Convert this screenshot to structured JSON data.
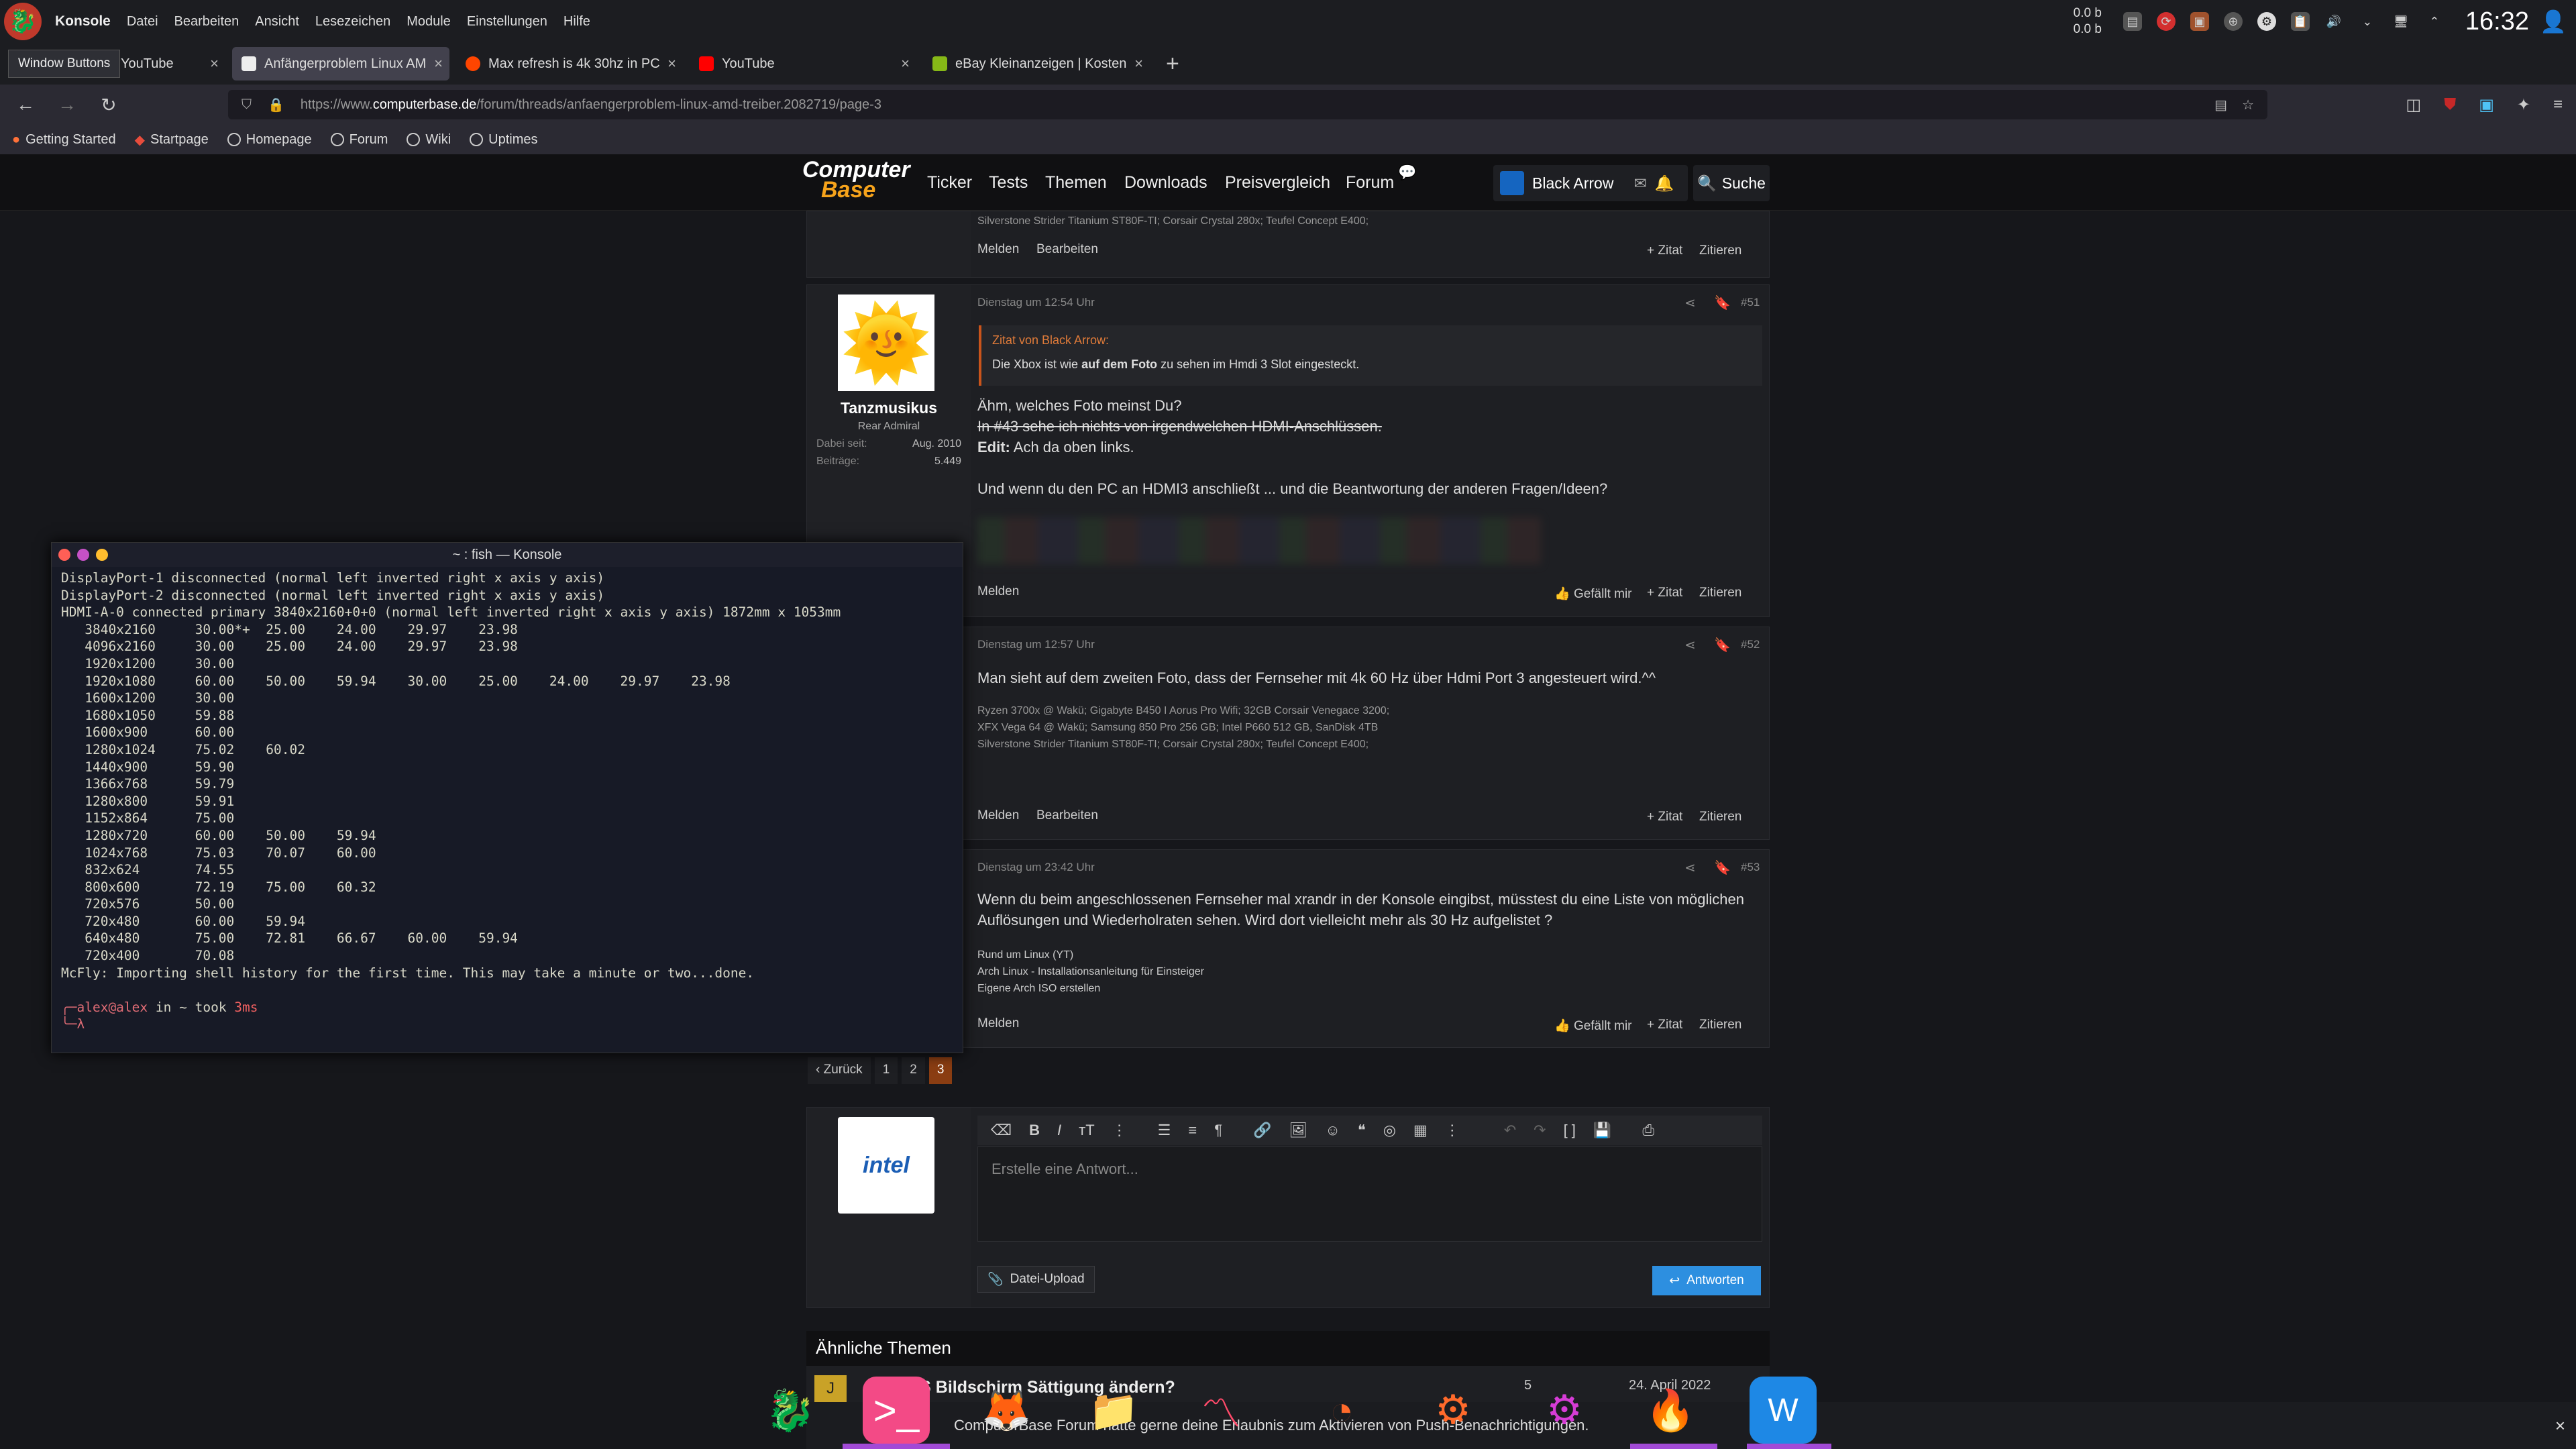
{
  "panel": {
    "app": "Konsole",
    "menus": [
      "Datei",
      "Bearbeiten",
      "Ansicht",
      "Lesezeichen",
      "Module",
      "Einstellungen",
      "Hilfe"
    ],
    "net_up": "0.0 b",
    "net_down": "0.0 b",
    "clock": "16:32"
  },
  "browser": {
    "window_buttons": "Window Buttons",
    "tabs": [
      {
        "label": "YouTube"
      },
      {
        "label": "Anfängerproblem Linux AMD"
      },
      {
        "label": "Max refresh is 4k 30hz in PC"
      },
      {
        "label": "YouTube"
      },
      {
        "label": "eBay Kleinanzeigen | Kosten"
      }
    ],
    "new_tab": "+",
    "url_scheme": "https://www.",
    "url_host": "computerbase.de",
    "url_path": "/forum/threads/anfaengerproblem-linux-amd-treiber.2082719/page-3",
    "bookmarks": [
      "Getting Started",
      "Startpage",
      "Homepage",
      "Forum",
      "Wiki",
      "Uptimes"
    ]
  },
  "site": {
    "logo_1": "Computer",
    "logo_2": "Base",
    "nav": [
      "Ticker",
      "Tests",
      "Themen",
      "Downloads",
      "Preisvergleich",
      "Forum"
    ],
    "user": "Black Arrow",
    "search": "Suche"
  },
  "post0": {
    "sig": "Silverstone Strider Titanium ST80F-TI; Corsair Crystal 280x; Teufel Concept E400;",
    "melden": "Melden",
    "bearbeiten": "Bearbeiten",
    "zitat": "+ Zitat",
    "zitieren": "Zitieren"
  },
  "post51": {
    "date": "Dienstag um 12:54 Uhr",
    "num": "#51",
    "author": "Tanzmusikus",
    "rank": "Rear Admiral",
    "joined_label": "Dabei seit:",
    "joined": "Aug. 2010",
    "posts_label": "Beiträge:",
    "posts": "5.449",
    "quote_by": "Zitat von Black Arrow:",
    "quote_pre": "Die Xbox ist wie ",
    "quote_bold": "auf dem Foto",
    "quote_post": " zu sehen im Hmdi 3 Slot eingesteckt.",
    "line1": "Ähm, welches Foto meinst Du?",
    "line2": "In #43 sehe ich nichts von irgendwelchen HDMI-Anschlüssen.",
    "edit_label": "Edit:",
    "edit_text": " Ach da oben links.",
    "line3": "Und wenn du den PC an HDMI3 anschließt ... und die Beantwortung der anderen Fragen/Ideen?",
    "melden": "Melden",
    "gefaellt": "Gefällt mir",
    "zitat": "+ Zitat",
    "zitieren": "Zitieren"
  },
  "post52": {
    "date": "Dienstag um 12:57 Uhr",
    "num": "#52",
    "text": "Man sieht auf dem zweiten Foto, dass der Fernseher mit 4k 60 Hz über Hdmi Port 3 angesteuert wird.^^",
    "sig1": "Ryzen 3700x @ Wakü; Gigabyte B450 I Aorus Pro Wifi; 32GB Corsair Venegace 3200;",
    "sig2": "XFX Vega 64 @ Wakü; Samsung 850 Pro 256 GB; Intel P660 512 GB, SanDisk 4TB",
    "sig3": "Silverstone Strider Titanium ST80F-TI; Corsair Crystal 280x; Teufel Concept E400;",
    "melden": "Melden",
    "bearbeiten": "Bearbeiten",
    "zitat": "+ Zitat",
    "zitieren": "Zitieren"
  },
  "post53": {
    "date": "Dienstag um 23:42 Uhr",
    "num": "#53",
    "text1": "Wenn du beim angeschlossenen Fernseher mal xrandr in der Konsole eingibst, müsstest du eine Liste von möglichen",
    "text2": "Auflösungen und Wiederholraten sehen. Wird dort vielleicht mehr als 30 Hz aufgelistet ?",
    "sig1": "Rund um Linux (YT)",
    "sig2": "Arch Linux - Installationsanleitung für Einsteiger",
    "sig3": "Eigene Arch ISO erstellen",
    "melden": "Melden",
    "gefaellt": "Gefällt mir",
    "zitat": "+ Zitat",
    "zitieren": "Zitieren"
  },
  "pager": {
    "back": "Zurück",
    "pages": [
      "1",
      "2",
      "3"
    ]
  },
  "reply": {
    "placeholder": "Erstelle eine Antwort...",
    "upload": "Datei-Upload",
    "submit": "Antworten"
  },
  "similar": {
    "title": "Ähnliche Themen",
    "thread": "[OP] OS Bildschirm Sättigung ändern?",
    "date": "24. April 2022",
    "count": "5"
  },
  "notif": {
    "text": "ComputerBase Forum hätte gerne deine Erlaubnis zum Aktivieren von Push-Benachrichtigungen.",
    "close": "×"
  },
  "konsole": {
    "title": "~ : fish — Konsole",
    "lines": [
      "DisplayPort-1 disconnected (normal left inverted right x axis y axis)",
      "DisplayPort-2 disconnected (normal left inverted right x axis y axis)",
      "HDMI-A-0 connected primary 3840x2160+0+0 (normal left inverted right x axis y axis) 1872mm x 1053mm",
      "   3840x2160     30.00*+  25.00    24.00    29.97    23.98",
      "   4096x2160     30.00    25.00    24.00    29.97    23.98",
      "   1920x1200     30.00",
      "   1920x1080     60.00    50.00    59.94    30.00    25.00    24.00    29.97    23.98",
      "   1600x1200     30.00",
      "   1680x1050     59.88",
      "   1600x900      60.00",
      "   1280x1024     75.02    60.02",
      "   1440x900      59.90",
      "   1366x768      59.79",
      "   1280x800      59.91",
      "   1152x864      75.00",
      "   1280x720      60.00    50.00    59.94",
      "   1024x768      75.03    70.07    60.00",
      "   832x624       74.55",
      "   800x600       72.19    75.00    60.32",
      "   720x576       50.00",
      "   720x480       60.00    59.94",
      "   640x480       75.00    72.81    66.67    60.00    59.94",
      "   720x400       70.08",
      "McFly: Importing shell history for the first time. This may take a minute or two...done."
    ],
    "prompt_user": "alex@alex",
    "prompt_mid": " in ~ took ",
    "prompt_time": "3ms",
    "prompt_char": "λ"
  },
  "dock": {
    "avatar_letter": "J"
  }
}
